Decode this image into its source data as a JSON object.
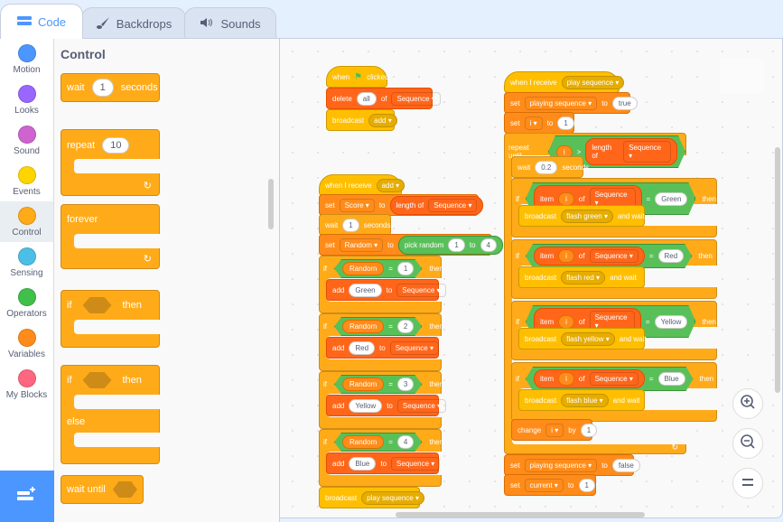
{
  "tabs": [
    {
      "label": "Code",
      "icon": "code-icon"
    },
    {
      "label": "Backdrops",
      "icon": "brush-icon"
    },
    {
      "label": "Sounds",
      "icon": "speaker-icon"
    }
  ],
  "categories": [
    {
      "label": "Motion",
      "color": "#4c97ff"
    },
    {
      "label": "Looks",
      "color": "#9966ff"
    },
    {
      "label": "Sound",
      "color": "#cf63cf"
    },
    {
      "label": "Events",
      "color": "#ffd500"
    },
    {
      "label": "Control",
      "color": "#ffab19"
    },
    {
      "label": "Sensing",
      "color": "#4cbfe6"
    },
    {
      "label": "Operators",
      "color": "#40bf4a"
    },
    {
      "label": "Variables",
      "color": "#ff8c1a"
    },
    {
      "label": "My Blocks",
      "color": "#ff6680"
    }
  ],
  "selected_category": "Control",
  "palette": {
    "title": "Control",
    "wait": {
      "label": "wait",
      "value": "1",
      "suffix": "seconds"
    },
    "repeat": {
      "label": "repeat",
      "value": "10"
    },
    "forever": {
      "label": "forever"
    },
    "if_then": {
      "if": "if",
      "then": "then"
    },
    "if_else": {
      "if": "if",
      "then": "then",
      "else": "else"
    },
    "wait_until": {
      "label": "wait until"
    }
  },
  "script1": {
    "hat": {
      "when": "when",
      "clicked": "clicked"
    },
    "delete": {
      "label": "delete",
      "value": "all",
      "of": "of",
      "list": "Sequence"
    },
    "broadcast": {
      "label": "broadcast",
      "msg": "add"
    }
  },
  "script2": {
    "hat": {
      "label": "when I receive",
      "msg": "add"
    },
    "set_score": {
      "set": "set",
      "var": "Score",
      "to": "to",
      "len": "length of",
      "list": "Sequence"
    },
    "wait": {
      "label": "wait",
      "value": "1",
      "suffix": "seconds"
    },
    "set_random": {
      "set": "set",
      "var": "Random",
      "to": "to",
      "pick": "pick random",
      "from": "1",
      "to2": "to",
      "max": "4"
    },
    "ifs": [
      {
        "if": "if",
        "var": "Random",
        "eq": "=",
        "val": "1",
        "then": "then",
        "add": "add",
        "item": "Green",
        "to": "to",
        "list": "Sequence"
      },
      {
        "if": "if",
        "var": "Random",
        "eq": "=",
        "val": "2",
        "then": "then",
        "add": "add",
        "item": "Red",
        "to": "to",
        "list": "Sequence"
      },
      {
        "if": "if",
        "var": "Random",
        "eq": "=",
        "val": "3",
        "then": "then",
        "add": "add",
        "item": "Yellow",
        "to": "to",
        "list": "Sequence"
      },
      {
        "if": "if",
        "var": "Random",
        "eq": "=",
        "val": "4",
        "then": "then",
        "add": "add",
        "item": "Blue",
        "to": "to",
        "list": "Sequence"
      }
    ],
    "broadcast": {
      "label": "broadcast",
      "msg": "play sequence"
    }
  },
  "script3": {
    "hat": {
      "label": "when I receive",
      "msg": "play sequence"
    },
    "set_playing": {
      "set": "set",
      "var": "playing sequence",
      "to": "to",
      "val": "true"
    },
    "set_i": {
      "set": "set",
      "var": "i",
      "to": "to",
      "val": "1"
    },
    "repeat_until": {
      "label": "repeat until",
      "var": "i",
      "op": ">",
      "len": "length of",
      "list": "Sequence"
    },
    "wait": {
      "label": "wait",
      "value": "0.2",
      "suffix": "seconds"
    },
    "ifs": [
      {
        "if": "if",
        "item": "item",
        "idx": "i",
        "of": "of",
        "list": "Sequence",
        "eq": "=",
        "val": "Green",
        "then": "then",
        "bc": "broadcast",
        "msg": "flash green",
        "andwait": "and wait"
      },
      {
        "if": "if",
        "item": "item",
        "idx": "i",
        "of": "of",
        "list": "Sequence",
        "eq": "=",
        "val": "Red",
        "then": "then",
        "bc": "broadcast",
        "msg": "flash red",
        "andwait": "and wait"
      },
      {
        "if": "if",
        "item": "item",
        "idx": "i",
        "of": "of",
        "list": "Sequence",
        "eq": "=",
        "val": "Yellow",
        "then": "then",
        "bc": "broadcast",
        "msg": "flash yellow",
        "andwait": "and wait"
      },
      {
        "if": "if",
        "item": "item",
        "idx": "i",
        "of": "of",
        "list": "Sequence",
        "eq": "=",
        "val": "Blue",
        "then": "then",
        "bc": "broadcast",
        "msg": "flash blue",
        "andwait": "and wait"
      }
    ],
    "change": {
      "label": "change",
      "var": "i",
      "by": "by",
      "val": "1"
    },
    "set_playing2": {
      "set": "set",
      "var": "playing sequence",
      "to": "to",
      "val": "false"
    },
    "set_current": {
      "set": "set",
      "var": "current",
      "to": "to",
      "val": "1"
    }
  },
  "dropdown_arrow": "▾",
  "zoom": {
    "in": "zoom-in",
    "out": "zoom-out",
    "reset": "="
  }
}
